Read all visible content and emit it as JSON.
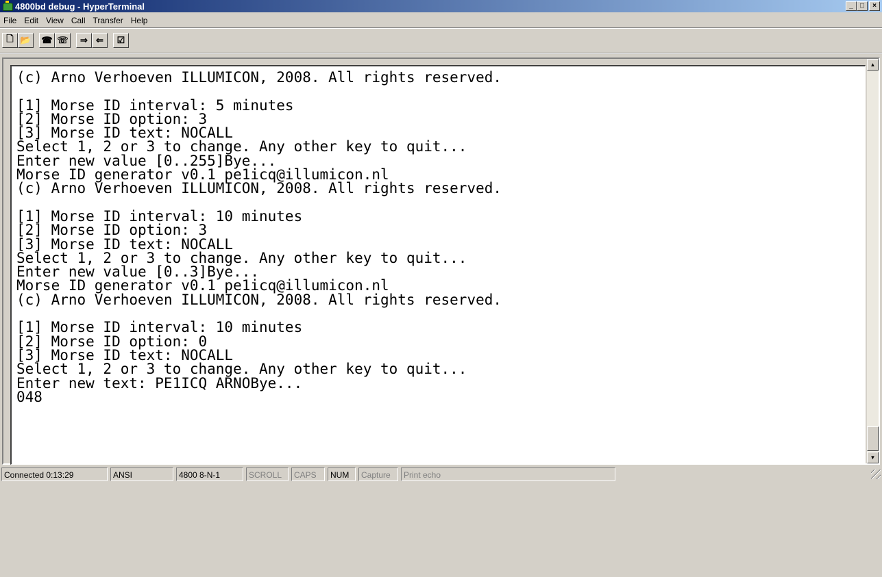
{
  "window": {
    "title": "4800bd debug - HyperTerminal",
    "icon": "hyperterminal-icon",
    "controls": {
      "minimize": "_",
      "maximize": "□",
      "close": "×"
    }
  },
  "menu": {
    "items": [
      "File",
      "Edit",
      "View",
      "Call",
      "Transfer",
      "Help"
    ]
  },
  "toolbar": {
    "buttons": [
      "new-icon",
      "open-icon",
      "connect-icon",
      "disconnect-icon",
      "send-icon",
      "receive-icon",
      "properties-icon"
    ],
    "glyphs": [
      "🗋",
      "📂",
      "☎",
      "☏",
      "⇒",
      "⇐",
      "☑"
    ]
  },
  "terminal": {
    "text": "(c) Arno Verhoeven ILLUMICON, 2008. All rights reserved.\n\n[1] Morse ID interval: 5 minutes\n[2] Morse ID option: 3\n[3] Morse ID text: NOCALL\nSelect 1, 2 or 3 to change. Any other key to quit...\nEnter new value [0..255]Bye...\nMorse ID generator v0.1 pe1icq@illumicon.nl\n(c) Arno Verhoeven ILLUMICON, 2008. All rights reserved.\n\n[1] Morse ID interval: 10 minutes\n[2] Morse ID option: 3\n[3] Morse ID text: NOCALL\nSelect 1, 2 or 3 to change. Any other key to quit...\nEnter new value [0..3]Bye...\nMorse ID generator v0.1 pe1icq@illumicon.nl\n(c) Arno Verhoeven ILLUMICON, 2008. All rights reserved.\n\n[1] Morse ID interval: 10 minutes\n[2] Morse ID option: 0\n[3] Morse ID text: NOCALL\nSelect 1, 2 or 3 to change. Any other key to quit...\nEnter new text: PE1ICQ ARNOBye...\n048"
  },
  "status": {
    "connected": "Connected 0:13:29",
    "emulation": "ANSI",
    "settings": "4800 8-N-1",
    "scroll": "SCROLL",
    "caps": "CAPS",
    "num": "NUM",
    "capture": "Capture",
    "print_echo": "Print echo"
  }
}
